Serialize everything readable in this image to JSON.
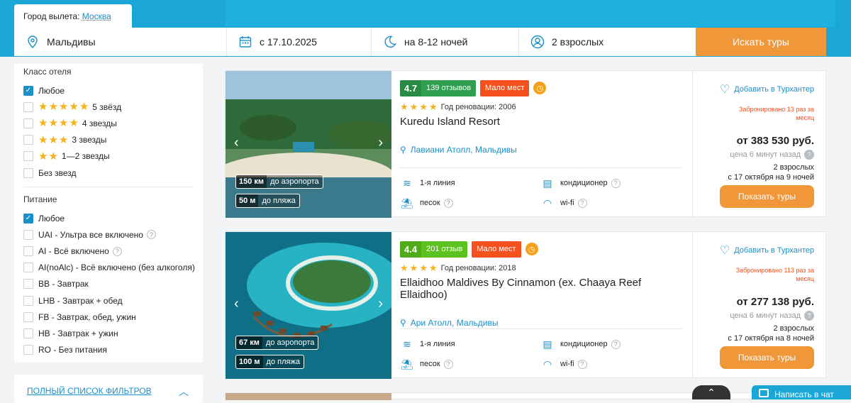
{
  "search": {
    "departure_label": "Город вылета:",
    "departure_city": "Москва",
    "destination": "Мальдивы",
    "date": "с 17.10.2025",
    "nights": "на 8-12 ночей",
    "guests": "2 взрослых",
    "search_button": "Искать туры"
  },
  "filters": {
    "hotel_class_title": "Класс отеля",
    "hotel_class": [
      {
        "label": "Любое",
        "checked": true,
        "stars": 0
      },
      {
        "label": "5 звёзд",
        "checked": false,
        "stars": 5
      },
      {
        "label": "4 звезды",
        "checked": false,
        "stars": 4
      },
      {
        "label": "3 звезды",
        "checked": false,
        "stars": 3
      },
      {
        "label": "1—2 звезды",
        "checked": false,
        "stars": 2
      },
      {
        "label": "Без звезд",
        "checked": false,
        "stars": 0
      }
    ],
    "meals_title": "Питание",
    "meals": [
      {
        "label": "Любое",
        "checked": true,
        "help": false
      },
      {
        "label": "UAI - Ультра все включено",
        "checked": false,
        "help": true
      },
      {
        "label": "AI - Всё включено",
        "checked": false,
        "help": true
      },
      {
        "label": "AI(noAlc) - Всё включено (без алкоголя)",
        "checked": false,
        "help": false
      },
      {
        "label": "BB - Завтрак",
        "checked": false,
        "help": false
      },
      {
        "label": "LHB - Завтрак + обед",
        "checked": false,
        "help": false
      },
      {
        "label": "FB - Завтрак, обед, ужин",
        "checked": false,
        "help": false
      },
      {
        "label": "HB - Завтрак + ужин",
        "checked": false,
        "help": false
      },
      {
        "label": "RO - Без питания",
        "checked": false,
        "help": false
      }
    ],
    "full_list": "ПОЛНЫЙ СПИСОК ФИЛЬТРОВ"
  },
  "hotels": [
    {
      "rating": "4.7",
      "reviews": "139 отзывов",
      "rating_color": "#2e9e4f",
      "few_places": "Мало мест",
      "renovation": "Год реновации: 2006",
      "name": "Kuredu Island Resort",
      "location": "Лавиани Атолл, Мальдивы",
      "airport_km": "150 км",
      "airport_label": "до аэропорта",
      "beach_m": "50 м",
      "beach_label": "до пляжа",
      "amenities": [
        "1-я линия",
        "кондиционер",
        "песок",
        "wi-fi"
      ],
      "favorite": "Добавить в Турхантер",
      "booked": "Забронировано 13 раз за месяц",
      "price": "от 383 530 руб.",
      "price_age": "цена 6 минут назад",
      "guests": "2 взрослых",
      "dates": "с 17 октября на 9 ночей",
      "button": "Показать туры"
    },
    {
      "rating": "4.4",
      "reviews": "201 отзыв",
      "rating_color": "#5cc21e",
      "few_places": "Мало мест",
      "renovation": "Год реновации: 2018",
      "name": "Ellaidhoo Maldives By Cinnamon (ex. Chaaya Reef Ellaidhoo)",
      "location": "Ари Атолл, Мальдивы",
      "airport_km": "67 км",
      "airport_label": "до аэропорта",
      "beach_m": "100 м",
      "beach_label": "до пляжа",
      "amenities": [
        "1-я линия",
        "кондиционер",
        "песок",
        "wi-fi"
      ],
      "favorite": "Добавить в Турхантер",
      "booked": "Забронировано 113 раз за месяц",
      "price": "от 277 138 руб.",
      "price_age": "цена 6 минут назад",
      "guests": "2 взрослых",
      "dates": "с 17 октября на 8 ночей",
      "button": "Показать туры"
    }
  ],
  "widgets": {
    "scroll_up": "⌃",
    "write_us": "Написать в чат"
  }
}
